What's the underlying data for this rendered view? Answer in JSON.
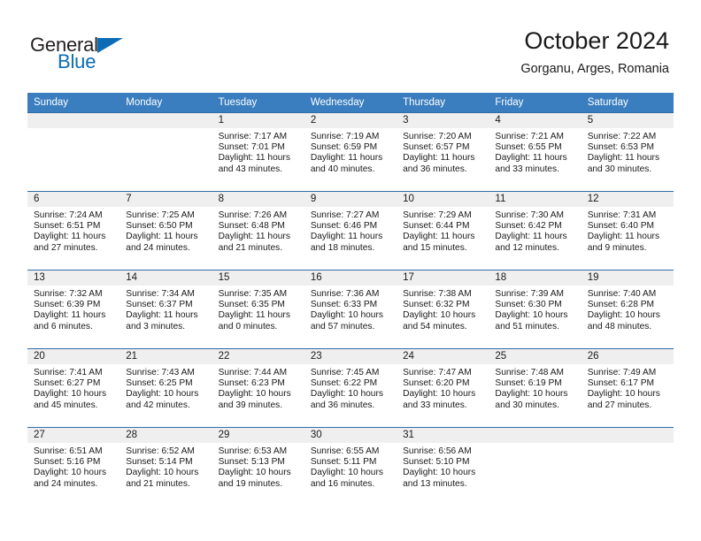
{
  "logo": {
    "word_one": "General",
    "word_two": "Blue",
    "triangle_icon": "logo-triangle-icon",
    "brand_color": "#0c6cb5"
  },
  "header": {
    "title": "October 2024",
    "subtitle": "Gorganu, Arges, Romania"
  },
  "calendar": {
    "header_color": "#3a7ebf",
    "daynum_band_color": "#efefef",
    "cell_border_color": "#2f6ea5",
    "weekday_headers": [
      "Sunday",
      "Monday",
      "Tuesday",
      "Wednesday",
      "Thursday",
      "Friday",
      "Saturday"
    ],
    "weeks": [
      [
        {
          "day": "",
          "lines": []
        },
        {
          "day": "",
          "lines": []
        },
        {
          "day": "1",
          "lines": [
            "Sunrise: 7:17 AM",
            "Sunset: 7:01 PM",
            "Daylight: 11 hours",
            "and 43 minutes."
          ]
        },
        {
          "day": "2",
          "lines": [
            "Sunrise: 7:19 AM",
            "Sunset: 6:59 PM",
            "Daylight: 11 hours",
            "and 40 minutes."
          ]
        },
        {
          "day": "3",
          "lines": [
            "Sunrise: 7:20 AM",
            "Sunset: 6:57 PM",
            "Daylight: 11 hours",
            "and 36 minutes."
          ]
        },
        {
          "day": "4",
          "lines": [
            "Sunrise: 7:21 AM",
            "Sunset: 6:55 PM",
            "Daylight: 11 hours",
            "and 33 minutes."
          ]
        },
        {
          "day": "5",
          "lines": [
            "Sunrise: 7:22 AM",
            "Sunset: 6:53 PM",
            "Daylight: 11 hours",
            "and 30 minutes."
          ]
        }
      ],
      [
        {
          "day": "6",
          "lines": [
            "Sunrise: 7:24 AM",
            "Sunset: 6:51 PM",
            "Daylight: 11 hours",
            "and 27 minutes."
          ]
        },
        {
          "day": "7",
          "lines": [
            "Sunrise: 7:25 AM",
            "Sunset: 6:50 PM",
            "Daylight: 11 hours",
            "and 24 minutes."
          ]
        },
        {
          "day": "8",
          "lines": [
            "Sunrise: 7:26 AM",
            "Sunset: 6:48 PM",
            "Daylight: 11 hours",
            "and 21 minutes."
          ]
        },
        {
          "day": "9",
          "lines": [
            "Sunrise: 7:27 AM",
            "Sunset: 6:46 PM",
            "Daylight: 11 hours",
            "and 18 minutes."
          ]
        },
        {
          "day": "10",
          "lines": [
            "Sunrise: 7:29 AM",
            "Sunset: 6:44 PM",
            "Daylight: 11 hours",
            "and 15 minutes."
          ]
        },
        {
          "day": "11",
          "lines": [
            "Sunrise: 7:30 AM",
            "Sunset: 6:42 PM",
            "Daylight: 11 hours",
            "and 12 minutes."
          ]
        },
        {
          "day": "12",
          "lines": [
            "Sunrise: 7:31 AM",
            "Sunset: 6:40 PM",
            "Daylight: 11 hours",
            "and 9 minutes."
          ]
        }
      ],
      [
        {
          "day": "13",
          "lines": [
            "Sunrise: 7:32 AM",
            "Sunset: 6:39 PM",
            "Daylight: 11 hours",
            "and 6 minutes."
          ]
        },
        {
          "day": "14",
          "lines": [
            "Sunrise: 7:34 AM",
            "Sunset: 6:37 PM",
            "Daylight: 11 hours",
            "and 3 minutes."
          ]
        },
        {
          "day": "15",
          "lines": [
            "Sunrise: 7:35 AM",
            "Sunset: 6:35 PM",
            "Daylight: 11 hours",
            "and 0 minutes."
          ]
        },
        {
          "day": "16",
          "lines": [
            "Sunrise: 7:36 AM",
            "Sunset: 6:33 PM",
            "Daylight: 10 hours",
            "and 57 minutes."
          ]
        },
        {
          "day": "17",
          "lines": [
            "Sunrise: 7:38 AM",
            "Sunset: 6:32 PM",
            "Daylight: 10 hours",
            "and 54 minutes."
          ]
        },
        {
          "day": "18",
          "lines": [
            "Sunrise: 7:39 AM",
            "Sunset: 6:30 PM",
            "Daylight: 10 hours",
            "and 51 minutes."
          ]
        },
        {
          "day": "19",
          "lines": [
            "Sunrise: 7:40 AM",
            "Sunset: 6:28 PM",
            "Daylight: 10 hours",
            "and 48 minutes."
          ]
        }
      ],
      [
        {
          "day": "20",
          "lines": [
            "Sunrise: 7:41 AM",
            "Sunset: 6:27 PM",
            "Daylight: 10 hours",
            "and 45 minutes."
          ]
        },
        {
          "day": "21",
          "lines": [
            "Sunrise: 7:43 AM",
            "Sunset: 6:25 PM",
            "Daylight: 10 hours",
            "and 42 minutes."
          ]
        },
        {
          "day": "22",
          "lines": [
            "Sunrise: 7:44 AM",
            "Sunset: 6:23 PM",
            "Daylight: 10 hours",
            "and 39 minutes."
          ]
        },
        {
          "day": "23",
          "lines": [
            "Sunrise: 7:45 AM",
            "Sunset: 6:22 PM",
            "Daylight: 10 hours",
            "and 36 minutes."
          ]
        },
        {
          "day": "24",
          "lines": [
            "Sunrise: 7:47 AM",
            "Sunset: 6:20 PM",
            "Daylight: 10 hours",
            "and 33 minutes."
          ]
        },
        {
          "day": "25",
          "lines": [
            "Sunrise: 7:48 AM",
            "Sunset: 6:19 PM",
            "Daylight: 10 hours",
            "and 30 minutes."
          ]
        },
        {
          "day": "26",
          "lines": [
            "Sunrise: 7:49 AM",
            "Sunset: 6:17 PM",
            "Daylight: 10 hours",
            "and 27 minutes."
          ]
        }
      ],
      [
        {
          "day": "27",
          "lines": [
            "Sunrise: 6:51 AM",
            "Sunset: 5:16 PM",
            "Daylight: 10 hours",
            "and 24 minutes."
          ]
        },
        {
          "day": "28",
          "lines": [
            "Sunrise: 6:52 AM",
            "Sunset: 5:14 PM",
            "Daylight: 10 hours",
            "and 21 minutes."
          ]
        },
        {
          "day": "29",
          "lines": [
            "Sunrise: 6:53 AM",
            "Sunset: 5:13 PM",
            "Daylight: 10 hours",
            "and 19 minutes."
          ]
        },
        {
          "day": "30",
          "lines": [
            "Sunrise: 6:55 AM",
            "Sunset: 5:11 PM",
            "Daylight: 10 hours",
            "and 16 minutes."
          ]
        },
        {
          "day": "31",
          "lines": [
            "Sunrise: 6:56 AM",
            "Sunset: 5:10 PM",
            "Daylight: 10 hours",
            "and 13 minutes."
          ]
        },
        {
          "day": "",
          "lines": []
        },
        {
          "day": "",
          "lines": []
        }
      ]
    ]
  }
}
